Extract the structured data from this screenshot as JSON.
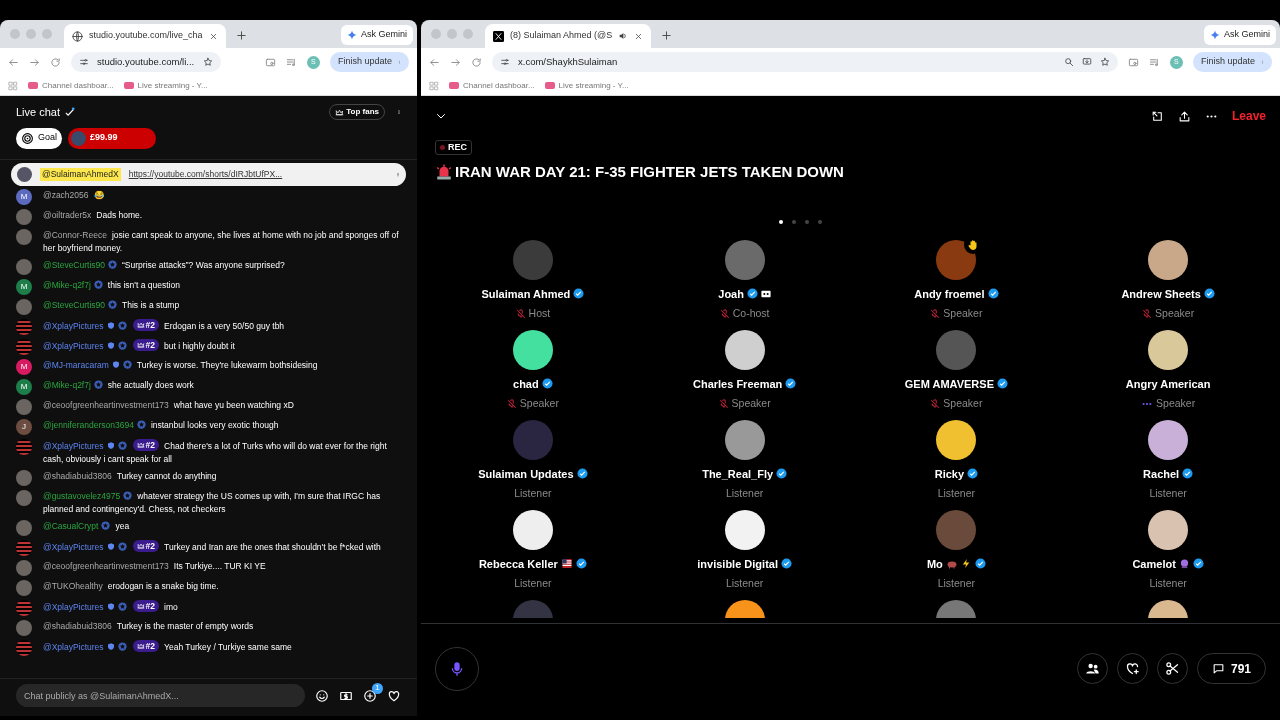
{
  "browsers": [
    {
      "tab_title": "studio.youtube.com/live_cha",
      "audio_playing": false,
      "address": "studio.youtube.com/li...",
      "ask_gemini": "Ask Gemini",
      "profile": "S",
      "update_button": "Finish update",
      "bookmarks": [
        "Channel dashboar...",
        "Live streaming - Y..."
      ]
    },
    {
      "tab_title": "(8) Sulaiman Ahmed (@S",
      "audio_playing": true,
      "address": "x.com/ShaykhSulaiman",
      "ask_gemini": "Ask Gemini",
      "profile": "S",
      "update_button": "Finish update",
      "bookmarks": [
        "Channel dashboar...",
        "Live streaming - Y..."
      ]
    }
  ],
  "live_chat": {
    "title": "Live chat",
    "top_fans": "Top fans",
    "goal": "Goal",
    "super_chat": "£99.99",
    "pinned": {
      "author": "@SulaimanAhmedX",
      "link": "https://youtube.com/shorts/dIRJbtUfPX..."
    },
    "messages": [
      {
        "author": "@zach2056",
        "avatar": {
          "kind": "letter",
          "letter": "M",
          "color": "#5c6bc0"
        },
        "verified": false,
        "moderator": false,
        "text": "😂"
      },
      {
        "author": "@oiltrader5x",
        "avatar": {
          "kind": "photo"
        },
        "verified": false,
        "moderator": false,
        "text": "Dads home."
      },
      {
        "author": "@Connor-Reece",
        "avatar": {
          "kind": "photo"
        },
        "verified": false,
        "moderator": false,
        "text": "josie cant speak to anyone, she lives at home with no job and sponges off of her boyfriend money."
      },
      {
        "author": "@SteveCurtis90",
        "avatar": {
          "kind": "photo"
        },
        "verified": true,
        "moderator": false,
        "text": "“Surprise attacks”? Was anyone surprised?"
      },
      {
        "author": "@Mike-q2f7j",
        "avatar": {
          "kind": "letter",
          "letter": "M",
          "color": "#1e7e4a"
        },
        "verified": true,
        "moderator": false,
        "text": "this isn't a question"
      },
      {
        "author": "@SteveCurtis90",
        "avatar": {
          "kind": "photo"
        },
        "verified": true,
        "moderator": false,
        "text": "This is a stump"
      },
      {
        "author": "@XplayPictures",
        "avatar": {
          "kind": "stripes"
        },
        "verified": true,
        "moderator": true,
        "rank": "#2",
        "text": "Erdogan is a very 50/50 guy tbh"
      },
      {
        "author": "@XplayPictures",
        "avatar": {
          "kind": "stripes"
        },
        "verified": true,
        "moderator": true,
        "rank": "#2",
        "text": "but i highly doubt it"
      },
      {
        "author": "@MJ-maracaram",
        "avatar": {
          "kind": "letter",
          "letter": "M",
          "color": "#d81b60"
        },
        "verified": true,
        "moderator": true,
        "text": "Turkey is worse. They're lukewarm bothsidesing"
      },
      {
        "author": "@Mike-q2f7j",
        "avatar": {
          "kind": "letter",
          "letter": "M",
          "color": "#1e7e4a"
        },
        "verified": true,
        "moderator": false,
        "text": "she actually does work"
      },
      {
        "author": "@ceoofgreenheartinvestment173",
        "avatar": {
          "kind": "photo"
        },
        "verified": false,
        "moderator": false,
        "text": "what have yu been watching xD"
      },
      {
        "author": "@jenniferanderson3694",
        "avatar": {
          "kind": "letter",
          "letter": "J",
          "color": "#6d4c41"
        },
        "verified": true,
        "moderator": false,
        "text": "instanbul looks very exotic though"
      },
      {
        "author": "@XplayPictures",
        "avatar": {
          "kind": "stripes"
        },
        "verified": true,
        "moderator": true,
        "rank": "#2",
        "text": "Chad there's a lot of Turks who will do wat ever for the right cash, obviously i cant speak for all"
      },
      {
        "author": "@shadiabuid3806",
        "avatar": {
          "kind": "photo"
        },
        "verified": false,
        "moderator": false,
        "text": "Turkey cannot do anything"
      },
      {
        "author": "@gustavovelez4975",
        "avatar": {
          "kind": "photo"
        },
        "verified": true,
        "moderator": false,
        "text": "whatever strategy the US comes up with, I'm sure that IRGC has planned and contingency'd. Chess, not checkers"
      },
      {
        "author": "@CasualCrypt",
        "avatar": {
          "kind": "photo"
        },
        "verified": true,
        "moderator": false,
        "text": "yea"
      },
      {
        "author": "@XplayPictures",
        "avatar": {
          "kind": "stripes"
        },
        "verified": true,
        "moderator": true,
        "rank": "#2",
        "text": "Turkey and Iran are the ones that shouldn't be f*cked with"
      },
      {
        "author": "@ceoofgreenheartinvestment173",
        "avatar": {
          "kind": "photo"
        },
        "verified": false,
        "moderator": false,
        "text": "Its Turkiye.... TUR KI YE"
      },
      {
        "author": "@TUKOhealthy",
        "avatar": {
          "kind": "photo"
        },
        "verified": false,
        "moderator": false,
        "text": "erodogan is a snake big time."
      },
      {
        "author": "@XplayPictures",
        "avatar": {
          "kind": "stripes"
        },
        "verified": true,
        "moderator": true,
        "rank": "#2",
        "text": "imo"
      },
      {
        "author": "@shadiabuid3806",
        "avatar": {
          "kind": "photo"
        },
        "verified": false,
        "moderator": false,
        "text": "Turkey is the master of empty words"
      },
      {
        "author": "@XplayPictures",
        "avatar": {
          "kind": "stripes"
        },
        "verified": true,
        "moderator": true,
        "rank": "#2",
        "text": "Yeah Turkey / Turkiye same same"
      }
    ],
    "input": {
      "placeholder": "Chat publicly as @SulaimanAhmedX...",
      "add_badge": "1"
    }
  },
  "space": {
    "leave": "Leave",
    "rec": "REC",
    "title": "IRAN WAR DAY 21: F-35 FIGHTER JETS TAKEN DOWN",
    "pages": [
      {
        "selected": true
      },
      {
        "selected": false
      },
      {
        "selected": false
      },
      {
        "selected": false
      }
    ],
    "participants": [
      {
        "name": "Sulaiman Ahmed",
        "verified": true,
        "hand_raised": false,
        "role": "Host",
        "muted": true,
        "speaking": false
      },
      {
        "name": "Joah",
        "verified": true,
        "badges": [
          {
            "kind": "tag"
          }
        ],
        "hand_raised": false,
        "role": "Co-host",
        "muted": true,
        "speaking": false
      },
      {
        "name": "Andy froemel",
        "verified": true,
        "hand_raised": true,
        "role": "Speaker",
        "muted": true,
        "speaking": false
      },
      {
        "name": "Andrew Sheets",
        "verified": true,
        "hand_raised": false,
        "role": "Speaker",
        "muted": true,
        "speaking": false
      },
      {
        "name": "chad",
        "verified": true,
        "hand_raised": false,
        "role": "Speaker",
        "muted": true,
        "speaking": false
      },
      {
        "name": "Charles Freeman",
        "verified": true,
        "hand_raised": false,
        "role": "Speaker",
        "muted": true,
        "speaking": false
      },
      {
        "name": "GEM AMAVERSE",
        "verified": true,
        "hand_raised": false,
        "role": "Speaker",
        "muted": true,
        "speaking": false
      },
      {
        "name": "Angry American",
        "verified": false,
        "hand_raised": false,
        "role": "Speaker",
        "muted": false,
        "speaking": true
      },
      {
        "name": "Sulaiman Updates",
        "verified": true,
        "hand_raised": false,
        "role": "Listener",
        "muted": false,
        "speaking": false
      },
      {
        "name": "The_Real_Fly",
        "verified": true,
        "hand_raised": false,
        "role": "Listener",
        "muted": false,
        "speaking": false
      },
      {
        "name": "Ricky",
        "verified": true,
        "hand_raised": false,
        "role": "Listener",
        "muted": false,
        "speaking": false
      },
      {
        "name": "Rachel",
        "verified": true,
        "hand_raised": false,
        "role": "Listener",
        "muted": false,
        "speaking": false
      },
      {
        "name": "Rebecca Keller",
        "verified": true,
        "badges": [
          {
            "kind": "flag"
          }
        ],
        "hand_raised": false,
        "role": "Listener",
        "muted": false,
        "speaking": false
      },
      {
        "name": "invisible Digital",
        "verified": true,
        "hand_raised": false,
        "role": "Listener",
        "muted": false,
        "speaking": false
      },
      {
        "name": "Mo",
        "verified": true,
        "badges": [
          {
            "kind": "pig"
          },
          {
            "kind": "bolt"
          }
        ],
        "hand_raised": false,
        "role": "Listener",
        "muted": false,
        "speaking": false
      },
      {
        "name": "Camelot",
        "verified": true,
        "badges": [
          {
            "kind": "orb"
          }
        ],
        "hand_raised": false,
        "role": "Listener",
        "muted": false,
        "speaking": false
      }
    ],
    "comments": "791"
  }
}
